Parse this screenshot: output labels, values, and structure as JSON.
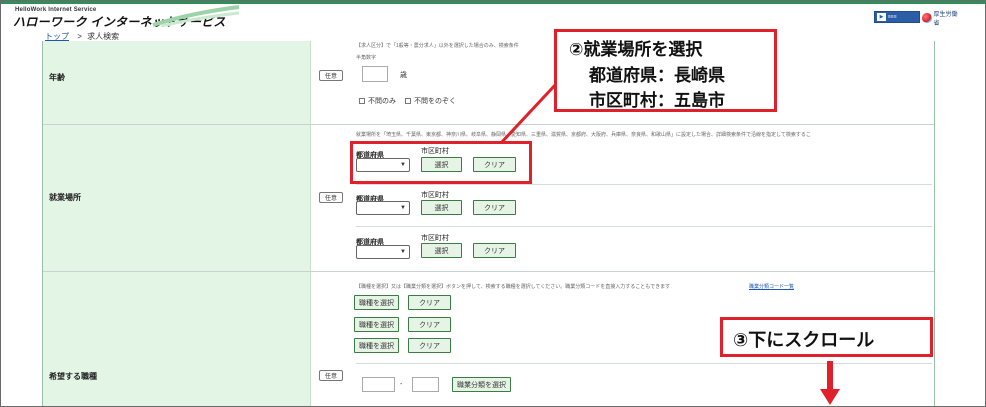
{
  "header": {
    "logo_en": "HelloWork Internet Service",
    "logo_ja": "ハローワーク インターネットサービス",
    "accent_color": "#2f8f5a",
    "right_button_icon": "screen-reader-icon",
    "ministry_logo": "mhlw-logo"
  },
  "breadcrumb": {
    "top_link": "トップ",
    "separator": ">",
    "current": "求人検索"
  },
  "age_section": {
    "label": "年齢",
    "optional_tag": "任意",
    "note_top": "【求人区分】で「1般等・農分求人」以外を選択した場合のみ、検索条件",
    "note_sub": "半角数字",
    "age_value": "",
    "age_unit": "歳",
    "check_only": "不問のみ",
    "check_exclude": "不問をのぞく"
  },
  "location_section": {
    "label": "就業場所",
    "optional_tag": "任意",
    "note": "就業場所を「埼玉県、千葉県、東京都、神奈川県、岐阜県、静岡県、愛知県、三重県、滋賀県、京都府、大阪府、兵庫県、奈良県、和歌山県」に設定した場合、詳細検索条件で沿線を指定して検索するこ",
    "prefecture_label": "都道府県",
    "city_label": "市区町村",
    "select_label": "選択",
    "clear_label": "クリア",
    "rows": [
      {
        "prefecture": ""
      },
      {
        "prefecture": ""
      },
      {
        "prefecture": ""
      }
    ]
  },
  "job_section": {
    "label": "希望する職種",
    "optional_tag": "任意",
    "note": "【職種を選択】又は【職業分類を選択】ボタンを押して、検索する職種を選択してください。職業分類コードを直接入力することもできます",
    "note_link": "職業分類コード一覧",
    "choose_label": "職種を選択",
    "clear_label": "クリア",
    "code_sep": "-",
    "classify_label": "職業分類を選択"
  },
  "annotations": {
    "step2_title": "②就業場所を選択",
    "step2_line1": "都道府県：長崎県",
    "step2_line2": "市区町村：五島市",
    "step3_title": "③下にスクロール",
    "color": "#e0202a"
  }
}
